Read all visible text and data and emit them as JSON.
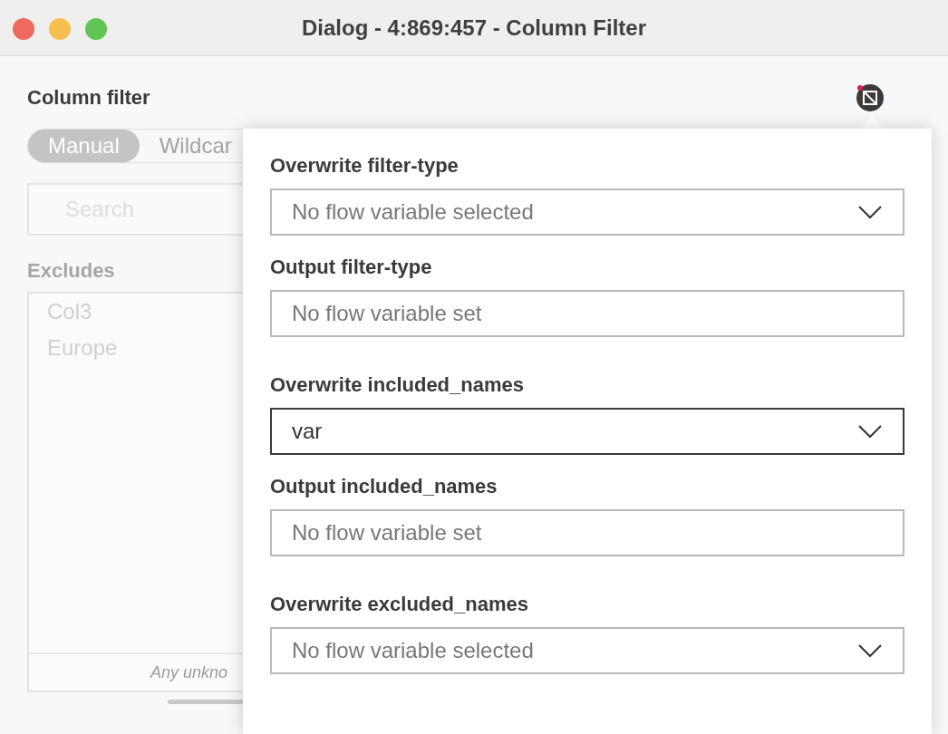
{
  "window": {
    "title": "Dialog - 4:869:457 - Column Filter"
  },
  "panel": {
    "title": "Column filter",
    "modes": [
      {
        "label": "Manual",
        "selected": true
      },
      {
        "label": "Wildcar",
        "selected": false
      }
    ],
    "search": {
      "placeholder": "Search"
    },
    "excludes": {
      "label": "Excludes",
      "items": [
        "Col3",
        "Europe"
      ],
      "footer": "Any unkno"
    }
  },
  "flow_variables": {
    "flag": true,
    "fields": [
      {
        "kind": "dropdown",
        "label": "Overwrite filter-type",
        "placeholder": "No flow variable selected"
      },
      {
        "kind": "output",
        "label": "Output filter-type",
        "placeholder": "No flow variable set"
      },
      {
        "kind": "dropdown",
        "label": "Overwrite included_names",
        "value": "var"
      },
      {
        "kind": "output",
        "label": "Output included_names",
        "placeholder": "No flow variable set"
      },
      {
        "kind": "dropdown",
        "label": "Overwrite excluded_names",
        "placeholder": "No flow variable selected"
      }
    ]
  }
}
